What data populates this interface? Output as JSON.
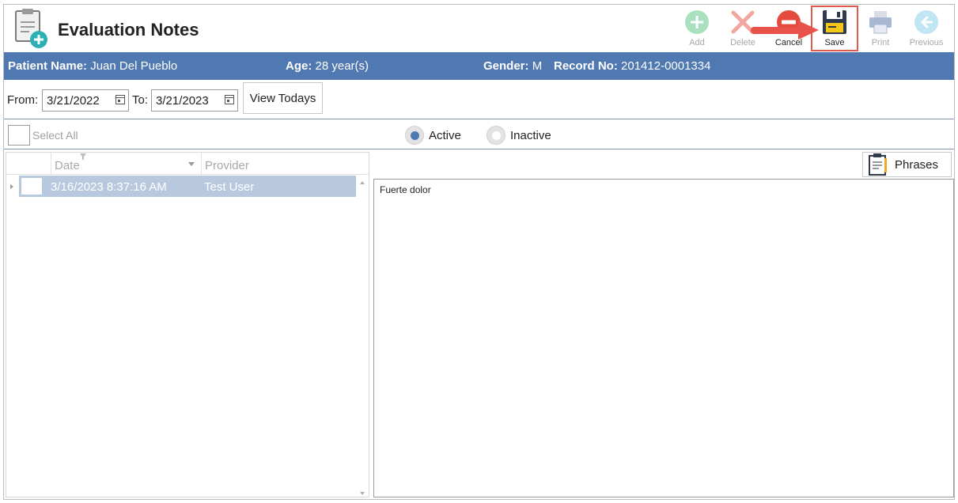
{
  "header": {
    "title": "Evaluation Notes",
    "app_icon": "clipboard-add-icon"
  },
  "toolbar": {
    "add_label": "Add",
    "delete_label": "Delete",
    "cancel_label": "Cancel",
    "save_label": "Save",
    "print_label": "Print",
    "previous_label": "Previous"
  },
  "patient": {
    "name_label": "Patient Name:",
    "name_value": "Juan Del Pueblo",
    "age_label": "Age:",
    "age_value": "28 year(s)",
    "gender_label": "Gender:",
    "gender_value": "M",
    "record_label": "Record No:",
    "record_value": "201412-0001334"
  },
  "filter": {
    "from_label": "From:",
    "from_value": "3/21/2022",
    "to_label": "To:",
    "to_value": "3/21/2023",
    "view_todays_label": "View Todays"
  },
  "selection": {
    "select_all_label": "Select All",
    "active_label": "Active",
    "inactive_label": "Inactive",
    "selected": "Active"
  },
  "grid": {
    "columns": [
      "Date",
      "Provider"
    ],
    "rows": [
      {
        "date": "3/16/2023 8:37:16 AM",
        "provider": "Test User"
      }
    ]
  },
  "phrases_label": "Phrases",
  "note_text": "Fuerte dolor",
  "colors": {
    "accent_blue": "#4f79b0",
    "row_selected": "#b8c9df",
    "highlight_red": "#e05a4e",
    "add_green": "#7dd3a0",
    "cancel_red": "#e44b3c",
    "save_yellow": "#f5c518"
  }
}
